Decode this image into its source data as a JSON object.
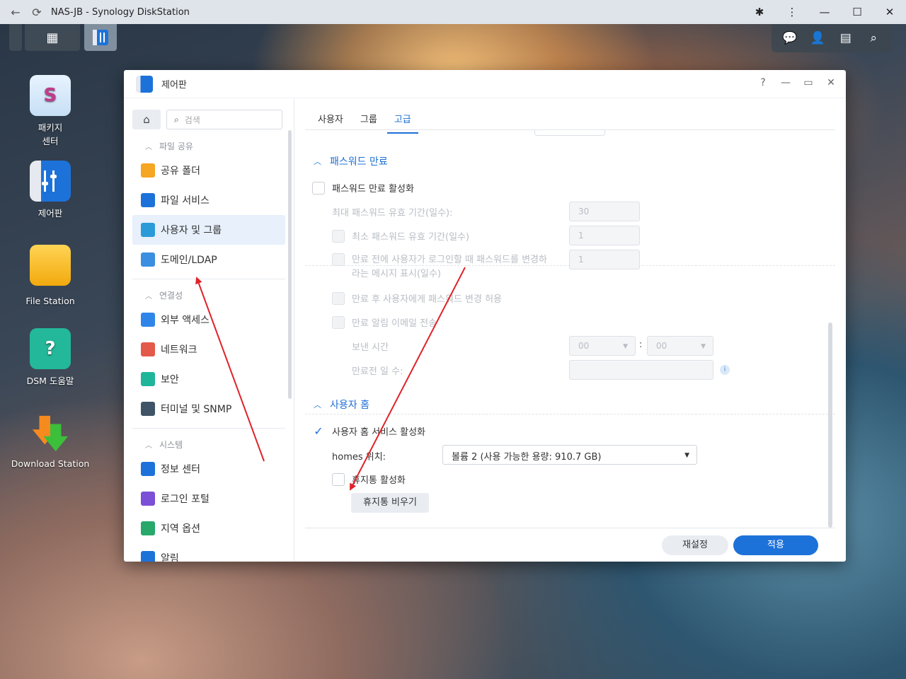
{
  "browser": {
    "title": "NAS-JB - Synology DiskStation",
    "icons": [
      "back-arrow-icon",
      "reload-icon",
      "extensions-icon",
      "menu-dots-icon",
      "minimize-icon",
      "maximize-icon",
      "close-icon"
    ]
  },
  "desktop": {
    "icons": [
      {
        "label": "패키지\n센터",
        "icon": "package-center-icon"
      },
      {
        "label": "제어판",
        "icon": "control-panel-icon"
      },
      {
        "label": "File Station",
        "icon": "folder-icon"
      },
      {
        "label": "DSM 도움말",
        "icon": "help-icon"
      },
      {
        "label": "Download Station",
        "icon": "download-icon"
      }
    ]
  },
  "window": {
    "title": "제어판",
    "controls": [
      "?",
      "—",
      "▭",
      "✕"
    ]
  },
  "sidebar": {
    "search_placeholder": "검색",
    "sections": [
      {
        "title": "파일 공유",
        "items": [
          {
            "label": "공유 폴더",
            "color": "#f5a623"
          },
          {
            "label": "파일 서비스",
            "color": "#1d72d9"
          },
          {
            "label": "사용자 및 그룹",
            "color": "#2a9bd8",
            "active": true
          },
          {
            "label": "도메인/LDAP",
            "color": "#3a8fe0"
          }
        ]
      },
      {
        "title": "연결성",
        "items": [
          {
            "label": "외부 액세스",
            "color": "#2f86e8"
          },
          {
            "label": "네트워크",
            "color": "#e45a4a"
          },
          {
            "label": "보안",
            "color": "#1fb59a"
          },
          {
            "label": "터미널 및 SNMP",
            "color": "#3f5466"
          }
        ]
      },
      {
        "title": "시스템",
        "items": [
          {
            "label": "정보 센터",
            "color": "#1d72d9"
          },
          {
            "label": "로그인 포털",
            "color": "#7b4fd6"
          },
          {
            "label": "지역 옵션",
            "color": "#28a86b"
          },
          {
            "label": "알림",
            "color": "#1d72d9"
          }
        ]
      }
    ]
  },
  "tabs": [
    "사용자",
    "그룹",
    "고급"
  ],
  "active_tab": "고급",
  "password_expiry": {
    "header": "패스워드 만료",
    "enable_label": "패스워드 만료 활성화",
    "max_age_label": "최대 패스워드 유효 기간(일수):",
    "max_age_value": "30",
    "min_age_label": "최소 패스워드 유효 기간(일수)",
    "min_age_value": "1",
    "prompt_label_1": "만료 전에 사용자가 로그인할 때 패스워드를 변경하",
    "prompt_label_2": "라는 메시지 표시(일수)",
    "prompt_value": "1",
    "allow_after_label": "만료 후 사용자에게 패스워드 변경 허용",
    "email_label": "만료 알림 이메일 전송",
    "send_time_label": "보낸 시간",
    "hour_value": "00",
    "minute_value": "00",
    "days_before_label": "만료전 일 수:"
  },
  "user_home": {
    "header": "사용자 홈",
    "enable_label": "사용자 홈 서비스 활성화",
    "location_label": "homes 위치:",
    "location_value": "볼륨 2 (사용 가능한 용량:  910.7 GB)",
    "recycle_label": "휴지통 활성화",
    "empty_button": "휴지통 비우기"
  },
  "buttons": {
    "reset": "재설정",
    "apply": "적용"
  },
  "colors": {
    "accent": "#1d72d9",
    "annotation_arrow": "#e0222a"
  }
}
